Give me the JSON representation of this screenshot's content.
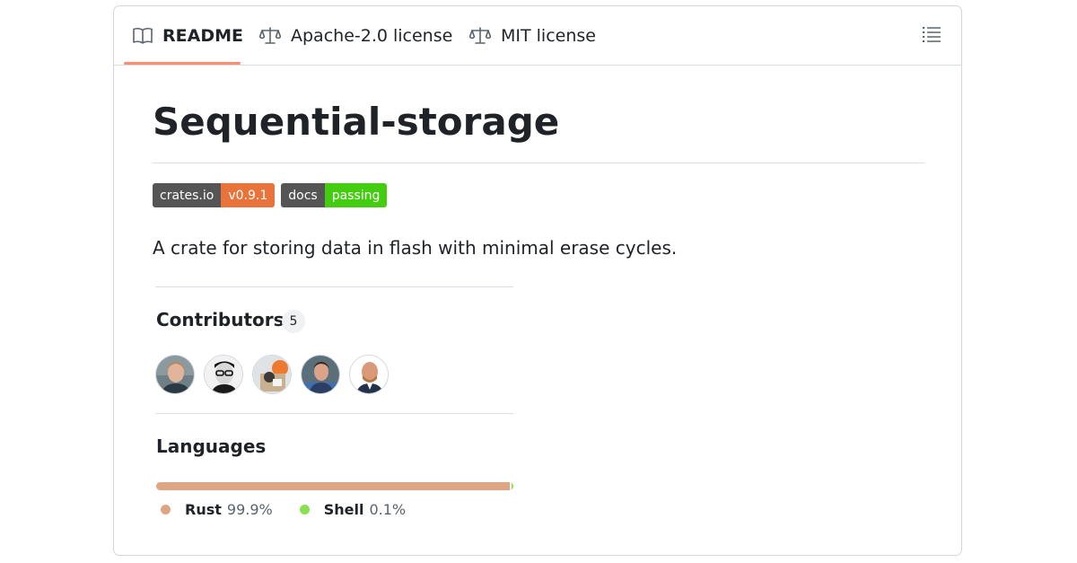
{
  "tabs": [
    {
      "label": "README",
      "icon": "book-icon",
      "selected": true
    },
    {
      "label": "Apache-2.0 license",
      "icon": "law-icon",
      "selected": false
    },
    {
      "label": "MIT license",
      "icon": "law-icon",
      "selected": false
    }
  ],
  "readme": {
    "title": "Sequential-storage",
    "badges": [
      {
        "label": "crates.io",
        "value": "v0.9.1",
        "color": "#e8743b"
      },
      {
        "label": "docs",
        "value": "passing",
        "color": "#44cc11"
      }
    ],
    "description": "A crate for storing data in flash with minimal erase cycles."
  },
  "contributors": {
    "title": "Contributors",
    "count": "5"
  },
  "languages": {
    "title": "Languages",
    "items": [
      {
        "name": "Rust",
        "percent": "99.9%",
        "color": "#dea584"
      },
      {
        "name": "Shell",
        "percent": "0.1%",
        "color": "#89e051"
      }
    ]
  }
}
